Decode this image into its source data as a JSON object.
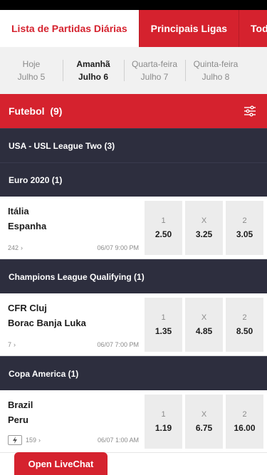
{
  "nav": {
    "tabs": [
      {
        "label": "Lista de Partidas Diárias"
      },
      {
        "label": "Principais Ligas"
      },
      {
        "label": "Todas"
      }
    ]
  },
  "days": [
    {
      "day": "Hoje",
      "date": "Julho 5"
    },
    {
      "day": "Amanhã",
      "date": "Julho 6"
    },
    {
      "day": "Quarta-feira",
      "date": "Julho 7"
    },
    {
      "day": "Quinta-feira",
      "date": "Julho 8"
    }
  ],
  "sport": {
    "title": "Futebol",
    "count": "(9)"
  },
  "leagues": [
    {
      "name": "USA - USL League Two (3)"
    },
    {
      "name": "Euro 2020 (1)"
    },
    {
      "name": "Champions League Qualifying (1)"
    },
    {
      "name": "Copa America (1)"
    }
  ],
  "matches": [
    {
      "home": "Itália",
      "away": "Espanha",
      "markets": "242",
      "datetime": "06/07  9:00 PM",
      "odds": [
        {
          "label": "1",
          "value": "2.50"
        },
        {
          "label": "X",
          "value": "3.25"
        },
        {
          "label": "2",
          "value": "3.05"
        }
      ]
    },
    {
      "home": "CFR Cluj",
      "away": "Borac Banja Luka",
      "markets": "7",
      "datetime": "06/07  7:00 PM",
      "odds": [
        {
          "label": "1",
          "value": "1.35"
        },
        {
          "label": "X",
          "value": "4.85"
        },
        {
          "label": "2",
          "value": "8.50"
        }
      ]
    },
    {
      "home": "Brazil",
      "away": "Peru",
      "markets": "159",
      "datetime": "06/07  1:00 AM",
      "odds": [
        {
          "label": "1",
          "value": "1.19"
        },
        {
          "label": "X",
          "value": "6.75"
        },
        {
          "label": "2",
          "value": "16.00"
        }
      ]
    }
  ],
  "chevron": "›",
  "livechat": {
    "label": "Open LiveChat"
  },
  "colors": {
    "brand_red": "#d5222e",
    "league_dark": "#2d2e3e",
    "odds_bg": "#ececec"
  },
  "icons": {
    "filter": "filter-icon",
    "chevron": "chevron-right-icon",
    "boost": "lightning-icon"
  }
}
